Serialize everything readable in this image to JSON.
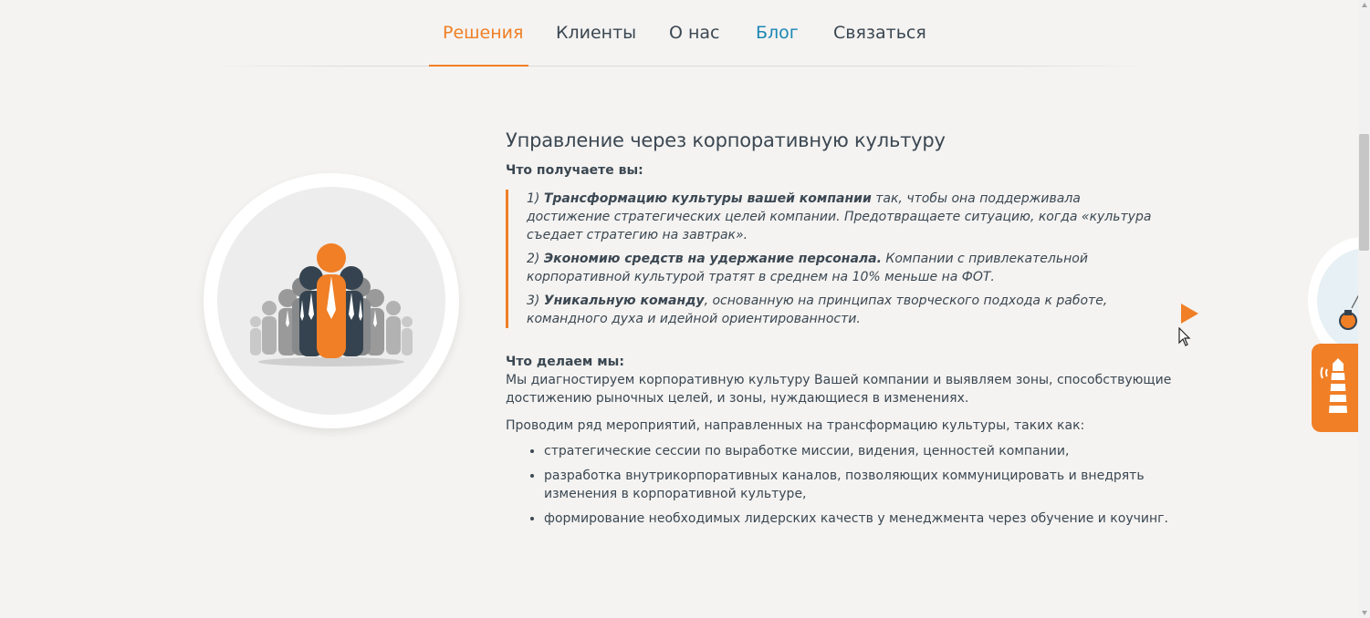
{
  "nav": {
    "items": [
      {
        "label": "Решения",
        "state": "active"
      },
      {
        "label": "Клиенты",
        "state": "normal"
      },
      {
        "label": "О нас",
        "state": "normal"
      },
      {
        "label": "Блог",
        "state": "highlight"
      },
      {
        "label": "Связаться",
        "state": "normal"
      }
    ]
  },
  "colors": {
    "accent": "#f07f26",
    "link": "#1a86b4",
    "text": "#3b4752",
    "background": "#f4f3f1"
  },
  "section": {
    "title": "Управление через корпоративную культуру",
    "get_heading": "Что получаете вы:",
    "benefits": [
      {
        "num": "1)",
        "bold": "Трансформацию культуры вашей компании",
        "text": " так, чтобы она поддерживала достижение стратегических целей компании. Предотвращаете ситуацию, когда «культура съедает стратегию на завтрак»."
      },
      {
        "num": "2)",
        "bold": "Экономию средств на удержание персонала.",
        "text": " Компании с привлекательной корпоративной культурой тратят в среднем на 10% меньше на ФОТ."
      },
      {
        "num": "3)",
        "bold": "Уникальную команду",
        "text": ", основанную на принципах творческого подхода к работе, командного духа и идейной ориентированности."
      }
    ],
    "do_heading": "Что делаем мы:",
    "do_text": "Мы диагностируем корпоративную культуру Вашей компании и выявляем зоны, способствующие достижению рыночных целей, и зоны, нуждающиеся в изменениях.",
    "events_intro": "Проводим ряд мероприятий, направленных на трансформацию культуры, таких как:",
    "events": [
      "стратегические сессии по выработке миссии, видения, ценностей компании,",
      "разработка внутрикорпоративных каналов, позволяющих коммуницировать и внедрять изменения в корпоративной культуре,",
      "формирование необходимых лидерских качеств у менеджмента через обучение и коучинг."
    ]
  },
  "icons": {
    "illustration": "team-people-icon",
    "next": "play-arrow-icon",
    "widget": "lighthouse-icon",
    "peek": "lightbulb-icon"
  }
}
